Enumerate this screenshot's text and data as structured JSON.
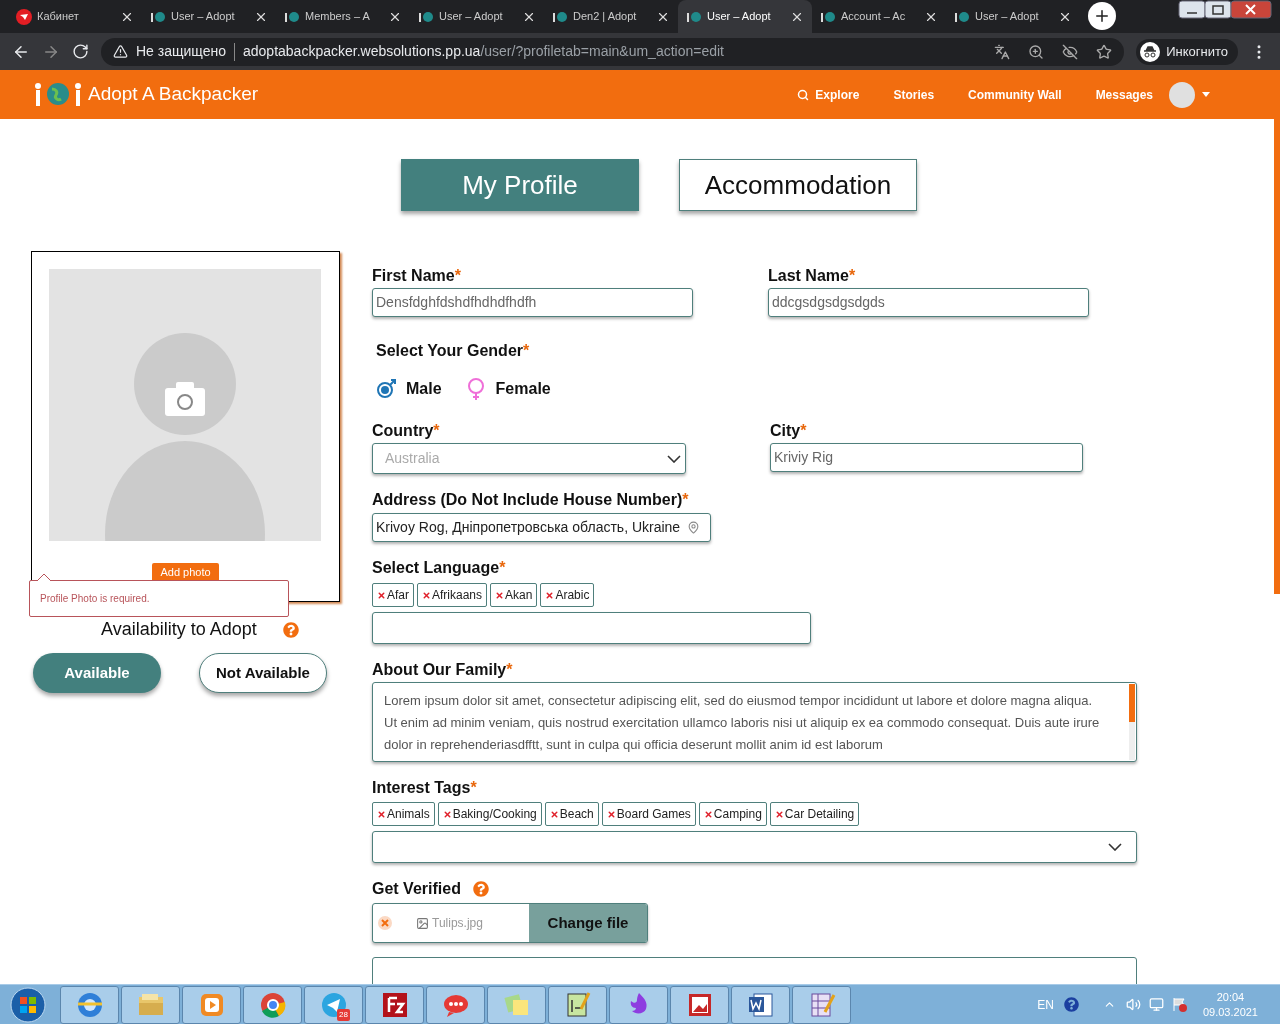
{
  "browser": {
    "tabs": [
      {
        "title": "Кабинет",
        "selected": false,
        "kind": "mail"
      },
      {
        "title": "User – Adopt",
        "selected": false,
        "kind": "site"
      },
      {
        "title": "Members – A",
        "selected": false,
        "kind": "site"
      },
      {
        "title": "User – Adopt",
        "selected": false,
        "kind": "site"
      },
      {
        "title": "Den2 | Adopt",
        "selected": false,
        "kind": "site"
      },
      {
        "title": "User – Adopt",
        "selected": true,
        "kind": "site"
      },
      {
        "title": "Account – Ac",
        "selected": false,
        "kind": "site"
      },
      {
        "title": "User – Adopt",
        "selected": false,
        "kind": "site"
      }
    ],
    "security": "Не защищено",
    "host": "adoptabackpacker.websolutions.pp.ua",
    "path": "/user/?profiletab=main&um_action=edit",
    "profile": "Инкогнито"
  },
  "nav": {
    "brand": "Adopt A Backpacker",
    "items": [
      {
        "label": "Explore",
        "kind": "search"
      },
      {
        "label": "Stories",
        "kind": "link"
      },
      {
        "label": "Community Wall",
        "kind": "link"
      },
      {
        "label": "Messages",
        "kind": "link"
      }
    ]
  },
  "profile_tabs": [
    {
      "label": "My Profile",
      "selected": true
    },
    {
      "label": "Accommodation",
      "selected": false
    }
  ],
  "photo": {
    "button": "Add photo",
    "error": "Profile Photo is required."
  },
  "availability": {
    "label": "Availability to Adopt",
    "options": [
      {
        "label": "Available",
        "selected": true
      },
      {
        "label": "Not Available",
        "selected": false
      }
    ]
  },
  "form": {
    "first_name": {
      "label": "First Name",
      "mark": "*",
      "value": "Densfdghfdshdfhdhdfhdfh"
    },
    "last_name": {
      "label": "Last Name",
      "mark": "*",
      "value": "ddcgsdgsdgsdgds"
    },
    "gender": {
      "label": "Select Your Gender",
      "mark": "*",
      "options": [
        {
          "label": "Male",
          "selected": true,
          "kind": "male"
        },
        {
          "label": "Female",
          "selected": false,
          "kind": "female"
        }
      ]
    },
    "country": {
      "label": "Country",
      "mark": "*",
      "value": "Australia"
    },
    "city": {
      "label": "City",
      "mark": "*",
      "value": "Kriviy Rig"
    },
    "address": {
      "label": "Address (Do Not Include House Number)",
      "mark": "*",
      "value": "Krivoy Rog, Дніпропетровська область, Ukraine"
    },
    "language": {
      "label": "Select Language",
      "mark": "*",
      "tags": [
        "Afar",
        "Afrikaans",
        "Akan",
        "Arabic"
      ]
    },
    "about": {
      "label": "About Our Family",
      "mark": "*",
      "value": "Lorem ipsum dolor sit amet, consectetur adipiscing elit, sed do eiusmod tempor incididunt ut labore et dolore magna aliqua. Ut enim ad minim veniam, quis nostrud exercitation ullamco laboris nisi ut aliquip ex ea commodo consequat. Duis aute irure dolor in reprehenderiasdfftt, sunt in culpa qui officia deserunt mollit anim id est laborum"
    },
    "interests": {
      "label": "Interest Tags",
      "mark": "*",
      "tags": [
        "Animals",
        "Baking/Cooking",
        "Beach",
        "Board Games",
        "Camping",
        "Car Detailing"
      ]
    },
    "verify": {
      "label": "Get Verified",
      "file": "Tulips.jpg",
      "button": "Change file"
    }
  },
  "taskbar": {
    "badge": "28",
    "lang": "EN",
    "time": "20:04",
    "date": "09.03.2021"
  }
}
